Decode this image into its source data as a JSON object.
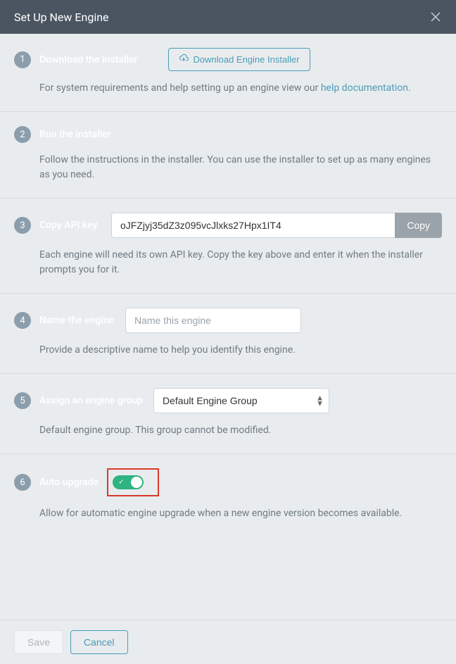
{
  "header": {
    "title": "Set Up New Engine"
  },
  "steps": {
    "s1": {
      "num": "1",
      "title": "Download the installer",
      "download_btn": "Download Engine Installer",
      "desc_pre": "For system requirements and help setting up an engine view our ",
      "desc_link": "help documentation",
      "desc_post": "."
    },
    "s2": {
      "num": "2",
      "title": "Run the installer",
      "desc": "Follow the instructions in the installer. You can use the installer to set up as many engines as you need."
    },
    "s3": {
      "num": "3",
      "title": "Copy API key",
      "api_key": "oJFZjyj35dZ3z095vcJlxks27Hpx1IT4",
      "copy_btn": "Copy",
      "desc": "Each engine will need its own API key. Copy the key above and enter it when the installer prompts you for it."
    },
    "s4": {
      "num": "4",
      "title": "Name the engine",
      "placeholder": "Name this engine",
      "desc": "Provide a descriptive name to help you identify this engine."
    },
    "s5": {
      "num": "5",
      "title": "Assign an engine group",
      "selected": "Default Engine Group",
      "desc": "Default engine group. This group cannot be modified."
    },
    "s6": {
      "num": "6",
      "title": "Auto upgrade",
      "desc": "Allow for automatic engine upgrade when a new engine version becomes available."
    }
  },
  "footer": {
    "save": "Save",
    "cancel": "Cancel"
  }
}
